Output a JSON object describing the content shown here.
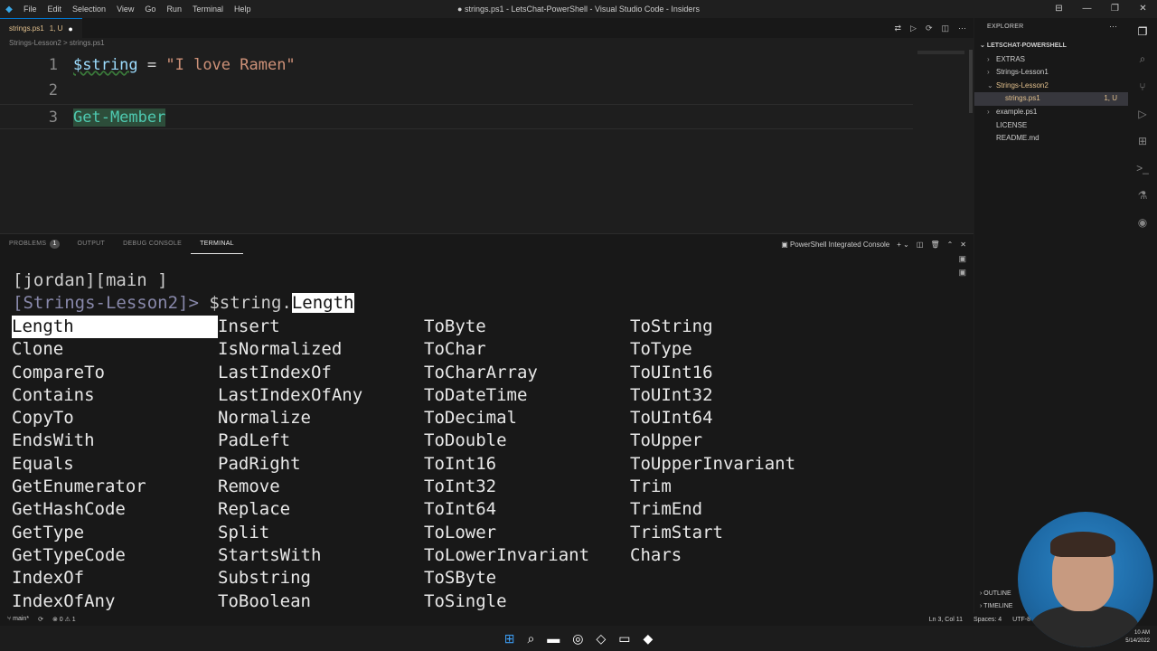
{
  "titlebar": {
    "menus": [
      "File",
      "Edit",
      "Selection",
      "View",
      "Go",
      "Run",
      "Terminal",
      "Help"
    ],
    "window_title": "● strings.ps1 - LetsChat-PowerShell - Visual Studio Code - Insiders",
    "controls": [
      "⊟",
      "—",
      "❐",
      "✕"
    ]
  },
  "editor": {
    "tab_label": "strings.ps1",
    "tab_status": "1, U",
    "tab_dot": "●",
    "breadcrumb": "Strings-Lesson2  >  strings.ps1",
    "lines": [
      {
        "num": "1",
        "var": "$string",
        "op": " = ",
        "str": "\"I love Ramen\""
      },
      {
        "num": "2"
      },
      {
        "num": "3",
        "cmdlet": "Get-Member"
      }
    ]
  },
  "panel": {
    "tabs": [
      "PROBLEMS",
      "OUTPUT",
      "DEBUG CONSOLE",
      "TERMINAL"
    ],
    "problems_count": "1",
    "console_name": "PowerShell Integrated Console",
    "prompt_line1": "[jordan][main ]",
    "prompt_line2_path": "[Strings-Lesson2]>",
    "prompt_command": " $string.",
    "prompt_selected": "Length",
    "completions": [
      "Length",
      "Clone",
      "CompareTo",
      "Contains",
      "CopyTo",
      "EndsWith",
      "Equals",
      "GetEnumerator",
      "GetHashCode",
      "GetType",
      "GetTypeCode",
      "IndexOf",
      "IndexOfAny",
      "Insert",
      "IsNormalized",
      "LastIndexOf",
      "LastIndexOfAny",
      "Normalize",
      "PadLeft",
      "PadRight",
      "Remove",
      "Replace",
      "Split",
      "StartsWith",
      "Substring",
      "ToBoolean",
      "ToByte",
      "ToChar",
      "ToCharArray",
      "ToDateTime",
      "ToDecimal",
      "ToDouble",
      "ToInt16",
      "ToInt32",
      "ToInt64",
      "ToLower",
      "ToLowerInvariant",
      "ToSByte",
      "ToSingle",
      "ToString",
      "ToType",
      "ToUInt16",
      "ToUInt32",
      "ToUInt64",
      "ToUpper",
      "ToUpperInvariant",
      "Trim",
      "TrimEnd",
      "TrimStart",
      "Chars"
    ]
  },
  "explorer": {
    "title": "EXPLORER",
    "root": "LETSCHAT-POWERSHELL",
    "items": [
      {
        "label": "EXTRAS",
        "chev": "›",
        "indent": 1,
        "color": "#cccccc"
      },
      {
        "label": "Strings-Lesson1",
        "chev": "›",
        "indent": 1,
        "color": "#cccccc"
      },
      {
        "label": "Strings-Lesson2",
        "chev": "⌄",
        "indent": 1,
        "color": "#e2c08d"
      },
      {
        "label": "strings.ps1",
        "chev": "",
        "indent": 2,
        "color": "#e2c08d",
        "status": "1, U"
      },
      {
        "label": "example.ps1",
        "chev": "›",
        "indent": 1,
        "color": "#cccccc"
      },
      {
        "label": "LICENSE",
        "chev": "",
        "indent": 1,
        "color": "#cccccc"
      },
      {
        "label": "README.md",
        "chev": "",
        "indent": 1,
        "color": "#cccccc"
      }
    ],
    "outline": "OUTLINE",
    "timeline": "TIMELINE"
  },
  "statusbar": {
    "branch": "main*",
    "sync": "⟳",
    "problems": "⊗ 0 ⚠ 1",
    "cursor": "Ln 3, Col 11",
    "spaces": "Spaces: 4",
    "encoding": "UTF-8"
  },
  "taskbar": {
    "clock_time": "10 AM",
    "clock_date": "5/14/2022"
  },
  "colors": {
    "accent": "#0078d4",
    "string": "#ce9178",
    "variable": "#9cdcfe",
    "cmdlet": "#4ec9b0",
    "modified": "#e2c08d"
  }
}
